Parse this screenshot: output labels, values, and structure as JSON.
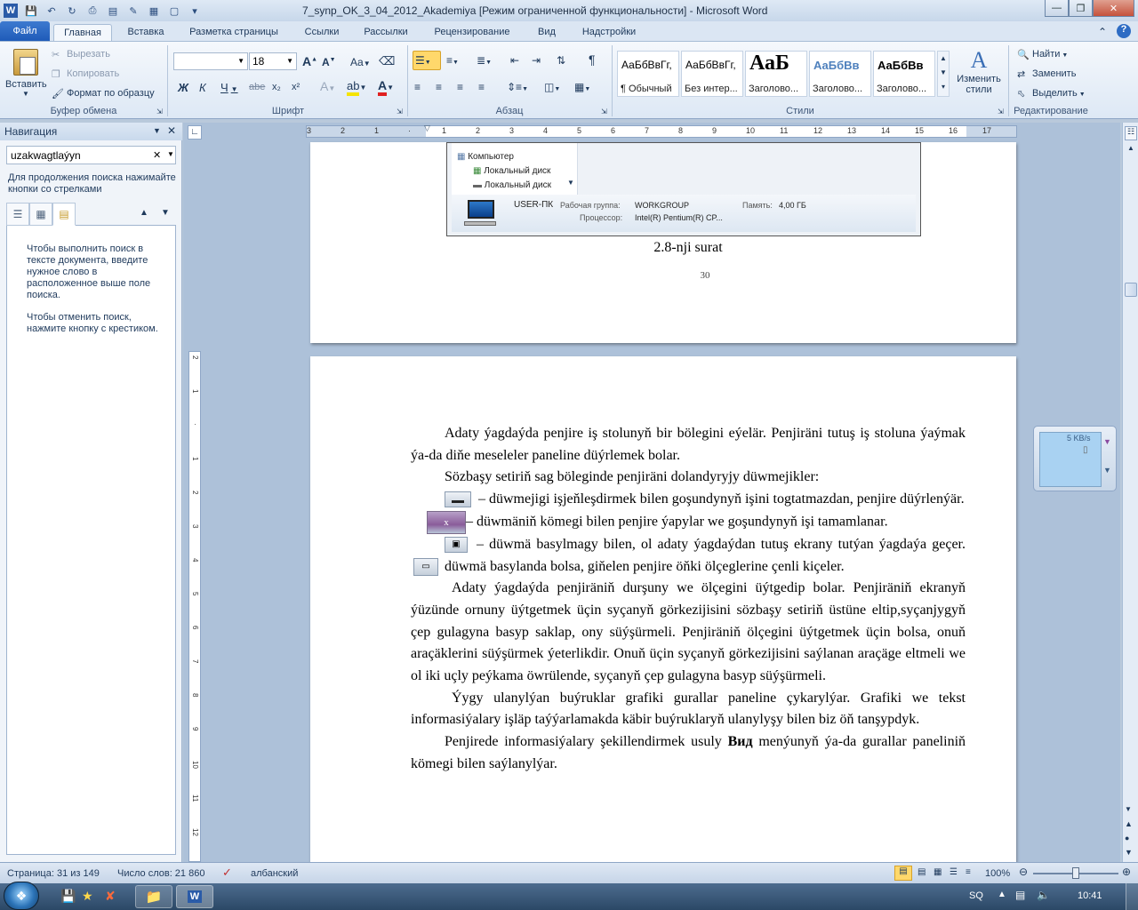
{
  "window": {
    "title": "7_synp_OK_3_04_2012_Akademiya [Режим ограниченной функциональности] - Microsoft Word"
  },
  "tabs": [
    "Файл",
    "Главная",
    "Вставка",
    "Разметка страницы",
    "Ссылки",
    "Рассылки",
    "Рецензирование",
    "Вид",
    "Надстройки"
  ],
  "clipboard": {
    "paste": "Вставить",
    "cut": "Вырезать",
    "copy": "Копировать",
    "format_painter": "Формат по образцу",
    "group": "Буфер обмена"
  },
  "font": {
    "size": "18",
    "group": "Шрифт",
    "bold": "Ж",
    "italic": "К",
    "underline": "Ч",
    "strike": "abe",
    "grow": "A",
    "shrink": "A",
    "case": "Aa"
  },
  "paragraph": {
    "group": "Абзац"
  },
  "styles": {
    "group": "Стили",
    "items": [
      {
        "sample": "АаБбВвГг,",
        "name": "¶ Обычный"
      },
      {
        "sample": "АаБбВвГг,",
        "name": "Без интер..."
      },
      {
        "sample": "АаБ",
        "name": "Заголово..."
      },
      {
        "sample": "АаБбВв",
        "name": "Заголово..."
      },
      {
        "sample": "АаБбВв",
        "name": "Заголово..."
      }
    ],
    "change": "Изменить стили"
  },
  "editing": {
    "group": "Редактирование",
    "find": "Найти",
    "replace": "Заменить",
    "select": "Выделить"
  },
  "nav": {
    "title": "Навигация",
    "search_value": "uzakwagtlaýyn",
    "hint": "Для продолжения поиска нажимайте кнопки со стрелками",
    "help1": "Чтобы выполнить поиск в тексте документа, введите нужное слово в расположенное выше поле поиска.",
    "help2": "Чтобы отменить поиск, нажмите кнопку с крестиком."
  },
  "ruler": {
    "h_ticks": [
      "3",
      "2",
      "1",
      "",
      "1",
      "2",
      "3",
      "4",
      "5",
      "6",
      "7",
      "8",
      "9",
      "10",
      "11",
      "12",
      "13",
      "14",
      "15",
      "16",
      "17"
    ],
    "v_ticks": [
      "2",
      "1",
      "",
      "1",
      "2",
      "3",
      "4",
      "5",
      "6",
      "7",
      "8",
      "9",
      "10",
      "11",
      "12",
      "13"
    ]
  },
  "screenshot": {
    "computer": "Компьютер",
    "disk1": "Локальный диск",
    "disk2": "Локальный диск",
    "pc_name": "USER-ПК",
    "workgroup_label": "Рабочая группа:",
    "workgroup": "WORKGROUP",
    "memory_label": "Память:",
    "memory": "4,00 ГБ",
    "cpu_label": "Процессор:",
    "cpu": "Intel(R) Pentium(R) CP..."
  },
  "page1": {
    "caption": "2.8-nji surat",
    "page_number": "30"
  },
  "page2": {
    "p1": "Adaty ýagdaýda penjire iş stolunyň bir bölegini eýelär. Penjiräni tutuş iş stoluna ýaýmak ýa-da diňe meseleler paneline düýrlemek bolar.",
    "p2": "Sözbaşy setiriň sag böleginde penjiräni dolandyryjy düwmejikler:",
    "p3": "– düwmejigi işjeňleşdirmek bilen goşundynyň işini togtatmazdan, penjire düýrlenýär.",
    "p4": "– düwmäniň kömegi bilen penjire ýapylar we goşundynyň işi tamamlanar.",
    "p5a": "– düwmä basylmagy bilen, ol adaty ýagdaýdan tutuş ekrany tutýan ýagdaýa geçer.",
    "p5b": "düwmä basylanda bolsa, giňelen penjire öňki ölçeglerine çenli kiçeler.",
    "p6": "Adaty ýagdaýda penjiräniň durşuny we ölçegini üýtgedip bolar. Penjiräniň ekranyň ýüzünde ornuny üýtgetmek üçin syçanyň görkezijisini sözbaşy setiriň üstüne eltip,syçanjygyň çep gulagyna basyp saklap, ony süýşürmeli. Penjiräniň ölçegini üýtgetmek üçin bolsa, onuň araçäklerini süýşürmek ýeterlikdir. Onuň üçin syçanyň görkezijisini saýlanan araçäge eltmeli we ol iki uçly peýkama öwrülende, syçanyň çep gulagyna basyp süýşürmeli.",
    "p7": "Ýygy ulanylýan buýruklar grafiki gurallar paneline çykarylýar. Grafiki we tekst informasiýalary işläp taýýarlamakda käbir buýruklaryň ulanylyşy bilen biz öň tanşypdyk.",
    "p8a": "Penjirede informasiýalary şekillendirmek usuly",
    "p8b": "Вид",
    "p8c": "menýunyň ýa-da gurallar paneliniň kömegi bilen saýlanylýar."
  },
  "netwidget": {
    "speed": "5 KB/s"
  },
  "statusbar": {
    "page": "Страница: 31 из 149",
    "words": "Число слов: 21 860",
    "language": "албанский",
    "zoom": "100%"
  },
  "taskbar": {
    "lang": "SQ",
    "time": "10:41"
  }
}
